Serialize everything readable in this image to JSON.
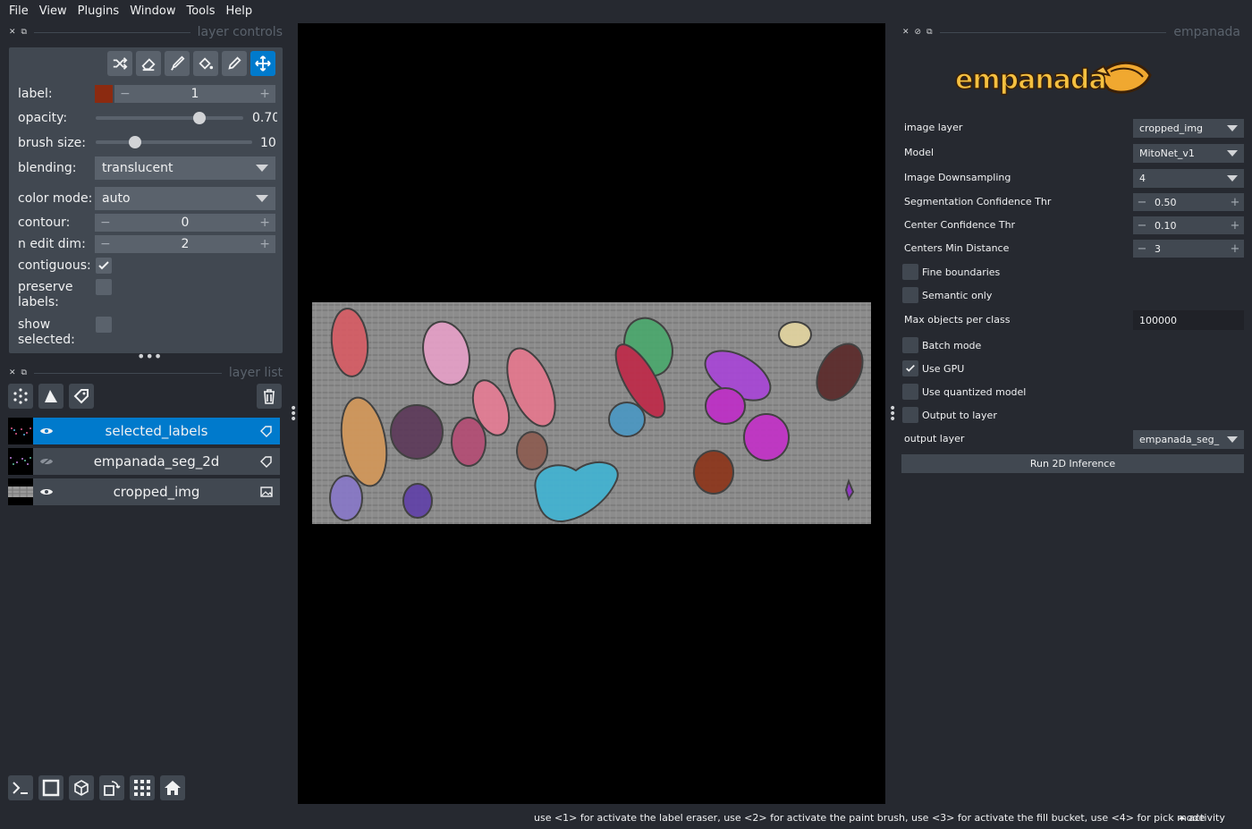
{
  "menu": [
    "File",
    "View",
    "Plugins",
    "Window",
    "Tools",
    "Help"
  ],
  "layer_controls": {
    "title": "layer controls",
    "label_label": "label:",
    "label_value": "1",
    "label_color": "#8b2a10",
    "opacity_label": "opacity:",
    "opacity_value": "0.70",
    "opacity_fraction": 0.7,
    "brush_label": "brush size:",
    "brush_value": "10",
    "blending_label": "blending:",
    "blending_value": "translucent",
    "color_mode_label": "color mode:",
    "color_mode_value": "auto",
    "contour_label": "contour:",
    "contour_value": "0",
    "n_edit_label": "n edit dim:",
    "n_edit_value": "2",
    "contiguous_label": "contiguous:",
    "contiguous_checked": true,
    "preserve_label": "preserve\nlabels:",
    "show_selected_label": "show\nselected:"
  },
  "layer_list": {
    "title": "layer list",
    "layers": [
      {
        "name": "selected_labels",
        "selected": true,
        "type": "labels"
      },
      {
        "name": "empanada_seg_2d",
        "selected": false,
        "type": "labels"
      },
      {
        "name": "cropped_img",
        "selected": false,
        "type": "image"
      }
    ]
  },
  "plugin": {
    "title": "empanada",
    "logo_text": "empanada",
    "image_layer_label": "image layer",
    "image_layer_value": "cropped_img",
    "model_label": "Model",
    "model_value": "MitoNet_v1",
    "downsampling_label": "Image Downsampling",
    "downsampling_value": "4",
    "seg_conf_label": "Segmentation Confidence Thr",
    "seg_conf_value": "0.50",
    "center_conf_label": "Center Confidence Thr",
    "center_conf_value": "0.10",
    "centers_min_label": "Centers Min Distance",
    "centers_min_value": "3",
    "fine_boundaries_label": "Fine boundaries",
    "semantic_only_label": "Semantic only",
    "max_objects_label": "Max objects per class",
    "max_objects_value": "100000",
    "batch_mode_label": "Batch mode",
    "use_gpu_label": "Use GPU",
    "use_quantized_label": "Use quantized model",
    "output_to_layer_label": "Output to layer",
    "output_layer_label": "output layer",
    "output_layer_value": "empanada_seg_",
    "run_label": "Run 2D Inference"
  },
  "status": {
    "message": "use <1> for activate the label eraser, use <2> for activate the paint brush, use <3> for activate the fill bucket, use <4> for pick mode",
    "activity": "activity"
  }
}
